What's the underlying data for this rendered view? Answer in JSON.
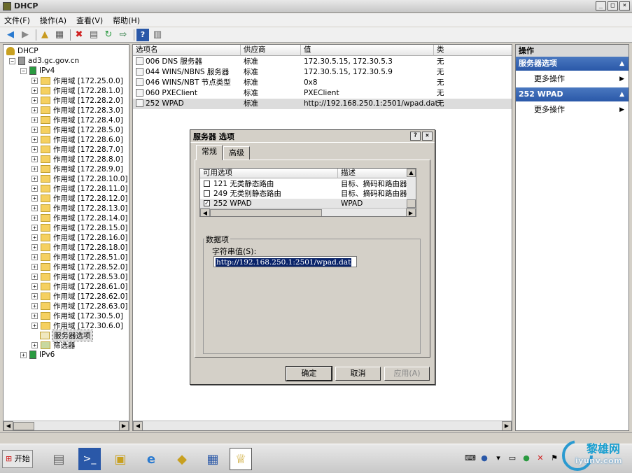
{
  "window": {
    "title": "DHCP",
    "minimize": "_",
    "restore": "□",
    "close": "×"
  },
  "menu": {
    "items": [
      "文件(F)",
      "操作(A)",
      "查看(V)",
      "帮助(H)"
    ]
  },
  "tree": {
    "root": "DHCP",
    "server": "ad3.gc.gov.cn",
    "ipv4": "IPv4",
    "scopes": [
      "作用域 [172.25.0.0]",
      "作用域 [172.28.1.0]",
      "作用域 [172.28.2.0]",
      "作用域 [172.28.3.0]",
      "作用域 [172.28.4.0]",
      "作用域 [172.28.5.0]",
      "作用域 [172.28.6.0]",
      "作用域 [172.28.7.0]",
      "作用域 [172.28.8.0]",
      "作用域 [172.28.9.0]",
      "作用域 [172.28.10.0]",
      "作用域 [172.28.11.0]",
      "作用域 [172.28.12.0]",
      "作用域 [172.28.13.0]",
      "作用域 [172.28.14.0]",
      "作用域 [172.28.15.0]",
      "作用域 [172.28.16.0]",
      "作用域 [172.28.18.0]",
      "作用域 [172.28.51.0]",
      "作用域 [172.28.52.0]",
      "作用域 [172.28.53.0]",
      "作用域 [172.28.61.0]",
      "作用域 [172.28.62.0]",
      "作用域 [172.28.63.0]",
      "作用域 [172.30.5.0]",
      "作用域 [172.30.6.0]"
    ],
    "server_options": "服务器选项",
    "filters": "筛选器",
    "ipv6": "IPv6"
  },
  "list": {
    "headers": [
      "选项名",
      "供应商",
      "值",
      "类"
    ],
    "rows": [
      {
        "name": "006 DNS 服务器",
        "vendor": "标准",
        "value": "172.30.5.15, 172.30.5.3",
        "cls": "无"
      },
      {
        "name": "044 WINS/NBNS 服务器",
        "vendor": "标准",
        "value": "172.30.5.15, 172.30.5.9",
        "cls": "无"
      },
      {
        "name": "046 WINS/NBT 节点类型",
        "vendor": "标准",
        "value": "0x8",
        "cls": "无"
      },
      {
        "name": "060 PXEClient",
        "vendor": "标准",
        "value": "PXEClient",
        "cls": "无"
      },
      {
        "name": "252 WPAD",
        "vendor": "标准",
        "value": "http://192.168.250.1:2501/wpad.dat",
        "cls": "无"
      }
    ]
  },
  "actions": {
    "header": "操作",
    "sections": [
      {
        "title": "服务器选项",
        "item": "更多操作"
      },
      {
        "title": "252 WPAD",
        "item": "更多操作"
      }
    ]
  },
  "dialog": {
    "title": "服务器 选项",
    "help_btn": "?",
    "close_btn": "×",
    "tabs": [
      "常规",
      "高级"
    ],
    "option_list": {
      "headers": [
        "可用选项",
        "描述"
      ],
      "rows": [
        {
          "checked": false,
          "name": "121 无类静态路由",
          "desc": "目标、摘码和路由器"
        },
        {
          "checked": false,
          "name": "249 无类别静态路由",
          "desc": "目标、摘码和路由器"
        },
        {
          "checked": true,
          "name": "252 WPAD",
          "desc": "WPAD"
        }
      ]
    },
    "data_group": "数据项",
    "string_label": "字符串值(S):",
    "string_value": "http://192.168.250.1:2501/wpad.dat",
    "buttons": {
      "ok": "确定",
      "cancel": "取消",
      "apply": "应用(A)"
    }
  },
  "taskbar": {
    "start": "开始"
  },
  "watermark": {
    "line1": "黎雄网",
    "line2": "iyunv.com"
  }
}
